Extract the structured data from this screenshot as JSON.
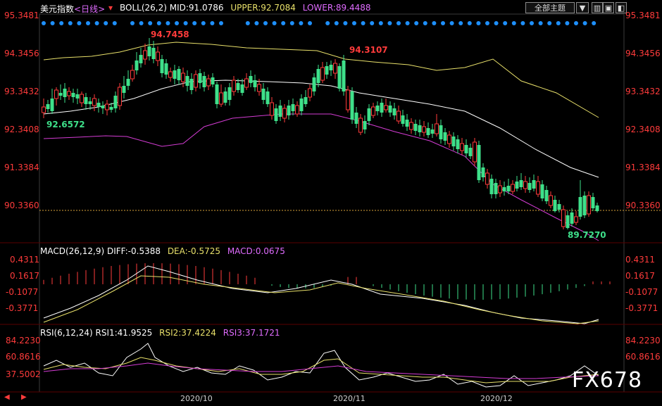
{
  "main_header": {
    "symbol": "美元指数",
    "period": "<日线>",
    "boll_label": "BOLL(26,2)",
    "mid": "MID:91.0786",
    "upper": "UPPER:92.7084",
    "lower": "LOWER:89.4488"
  },
  "toolbar": {
    "theme_select": "全部主题",
    "dropdown_icon": "▼"
  },
  "price_axis": [
    "95.3481",
    "94.3456",
    "93.3432",
    "92.3408",
    "91.3384",
    "90.3360"
  ],
  "annotations": {
    "high1": "94.7458",
    "high2": "94.3107",
    "low1": "92.6572",
    "low2": "89.7270"
  },
  "macd_header": {
    "label": "MACD(26,12,9)",
    "diff": "DIFF:-0.5388",
    "dea": "DEA:-0.5725",
    "macd": "MACD:0.0675"
  },
  "macd_axis": [
    "0.4311",
    "0.1617",
    "-0.1077",
    "-0.3771"
  ],
  "rsi_header": {
    "label": "RSI(6,12,24)",
    "rsi1": "RSI1:41.9525",
    "rsi2": "RSI2:37.4224",
    "rsi3": "RSI3:37.1721"
  },
  "rsi_axis": [
    "84.2230",
    "60.8616",
    "37.5002"
  ],
  "x_axis": [
    "2020/10",
    "2020/11",
    "2020/12"
  ],
  "watermark": "FX678",
  "colors": {
    "up": "#ff3b3b",
    "down": "#3ee08a",
    "upper_band": "#e8e06a",
    "mid_band": "#ffffff",
    "lower_band": "#d43cd4",
    "dea": "#e8e06a",
    "rsi3": "#d43cd4",
    "dots": "#1e90ff"
  }
}
